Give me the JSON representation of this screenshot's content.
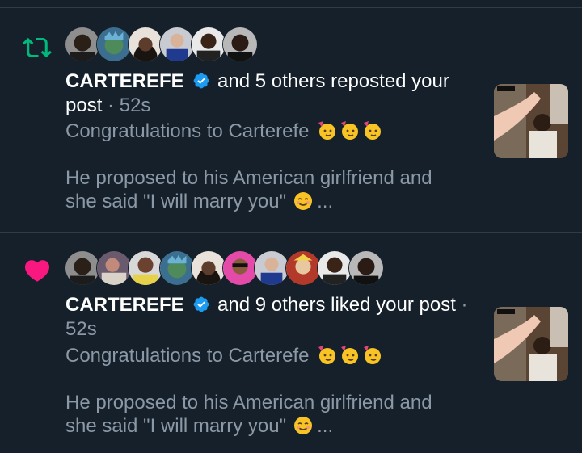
{
  "notifications": [
    {
      "type": "repost",
      "icon": "repost-icon",
      "actor_name": "CARTEREFE",
      "action_text": "and 5 others reposted your",
      "action_text_2": "post",
      "time": "52s",
      "post_line_1": "Congratulations to Carterefe",
      "post_line_2": "He proposed to his American girlfriend and",
      "post_line_3": "she said \"I will marry you\"",
      "ellipsis": "...",
      "accent_color": "#00ba7c"
    },
    {
      "type": "like",
      "icon": "heart-icon",
      "actor_name": "CARTEREFE",
      "action_text": "and 9 others liked your post",
      "time": "52s",
      "post_line_1": "Congratulations to Carterefe",
      "post_line_2": "He proposed to his American girlfriend and",
      "post_line_3": "she said \"I will marry you\"",
      "ellipsis": "...",
      "accent_color": "#f91880"
    }
  ],
  "colors": {
    "background": "#15202b",
    "divider": "#2f3b47",
    "muted": "#8b98a5",
    "verified": "#1d9bf0"
  }
}
